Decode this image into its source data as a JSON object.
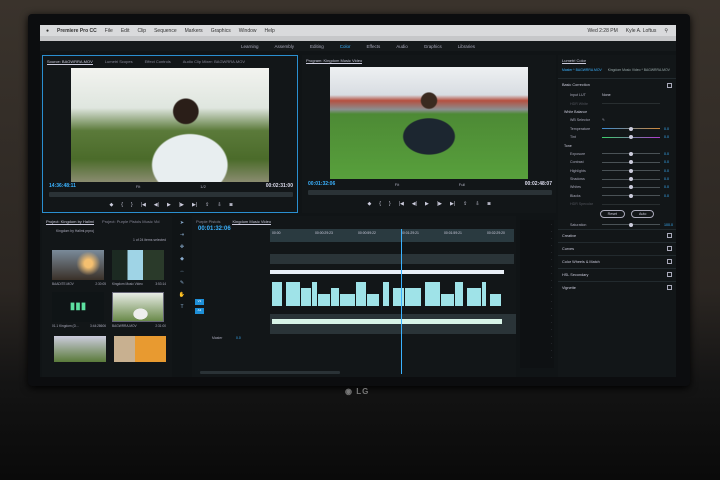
{
  "menubar": {
    "app": "Premiere Pro CC",
    "items": [
      "File",
      "Edit",
      "Clip",
      "Sequence",
      "Markers",
      "Graphics",
      "Window",
      "Help"
    ],
    "clock": "Wed 2:28 PM",
    "user": "Kyle A. Loftus"
  },
  "workspaces": [
    {
      "label": "Learning"
    },
    {
      "label": "Assembly"
    },
    {
      "label": "Editing"
    },
    {
      "label": "Color",
      "active": true
    },
    {
      "label": "Effects"
    },
    {
      "label": "Audio"
    },
    {
      "label": "Graphics"
    },
    {
      "label": "Libraries"
    }
  ],
  "source": {
    "tabs": [
      "Source: BAGWRRA.MOV",
      "Lumetri Scopes",
      "Effect Controls",
      "Audio Clip Mixer: BAGWRRA.MOV"
    ],
    "timecode": "14:36:48:11",
    "fit": "Fit",
    "ratio": "1/2",
    "duration": "00:02:31:00"
  },
  "program": {
    "title": "Program: Kingdom Music Video",
    "timecode": "00:01:32:06",
    "fit": "Fit",
    "quality": "Full",
    "duration": "00:02:48:07"
  },
  "controls": [
    "◆",
    "{",
    "}",
    "|◀",
    "◀|",
    "▶",
    "|▶",
    "▶|",
    "⇪",
    "⇩",
    "◙"
  ],
  "lumetri": {
    "title": "Lumetri Color",
    "master": "Master * BAGWRRA.MOV",
    "sequence": "Kingdom Music Video * BAGWRRA.MOV",
    "basic": "Basic Correction",
    "input_lut_label": "Input LUT",
    "input_lut": "None",
    "hdr_white": "HDR White",
    "white_balance": "White Balance",
    "wb_selector": "WB Selector",
    "wb": [
      {
        "label": "Temperature",
        "value": "0.0"
      },
      {
        "label": "Tint",
        "value": "0.0"
      }
    ],
    "tone_label": "Tone",
    "tone": [
      {
        "label": "Exposure",
        "value": "0.0"
      },
      {
        "label": "Contrast",
        "value": "0.0"
      },
      {
        "label": "Highlights",
        "value": "0.0"
      },
      {
        "label": "Shadows",
        "value": "0.0"
      },
      {
        "label": "Whites",
        "value": "0.0"
      },
      {
        "label": "Blacks",
        "value": "0.0"
      }
    ],
    "hdr_specular": "HDR Specular",
    "reset": "Reset",
    "auto": "Auto",
    "saturation_label": "Saturation",
    "saturation": "100.0",
    "sections": [
      "Creative",
      "Curves",
      "Color Wheels & Match",
      "HSL Secondary",
      "Vignette"
    ]
  },
  "project": {
    "tabs": [
      "Project: Kingdom by Halimi",
      "Project: Purple Pistols Music Vid"
    ],
    "file": "Kingdom by Halimi.prproj",
    "selection": "1 of 24 items selected",
    "items": [
      {
        "name": "BAADITE.MOV",
        "dur": "2:30:05"
      },
      {
        "name": "Kingdom Music Video",
        "dur": "3:53:14"
      },
      {
        "name": "01.1 Kingdom (D...",
        "dur": "3:44:28606"
      },
      {
        "name": "BAGWRRA.MOV",
        "dur": "2:31:00"
      }
    ]
  },
  "timeline": {
    "tabs": [
      "Purple Pistols",
      "Kingdom Music Video"
    ],
    "timecode": "00:01:32:06",
    "ruler": [
      "00:00",
      "00:00:29:23",
      "00:00:59:22",
      "00:01:29:21",
      "00:01:59:21",
      "00:02:29:20"
    ],
    "video_track": "V1",
    "audio_track": "A1",
    "master": "Master",
    "master_value": "0.0"
  },
  "brand": "LG"
}
